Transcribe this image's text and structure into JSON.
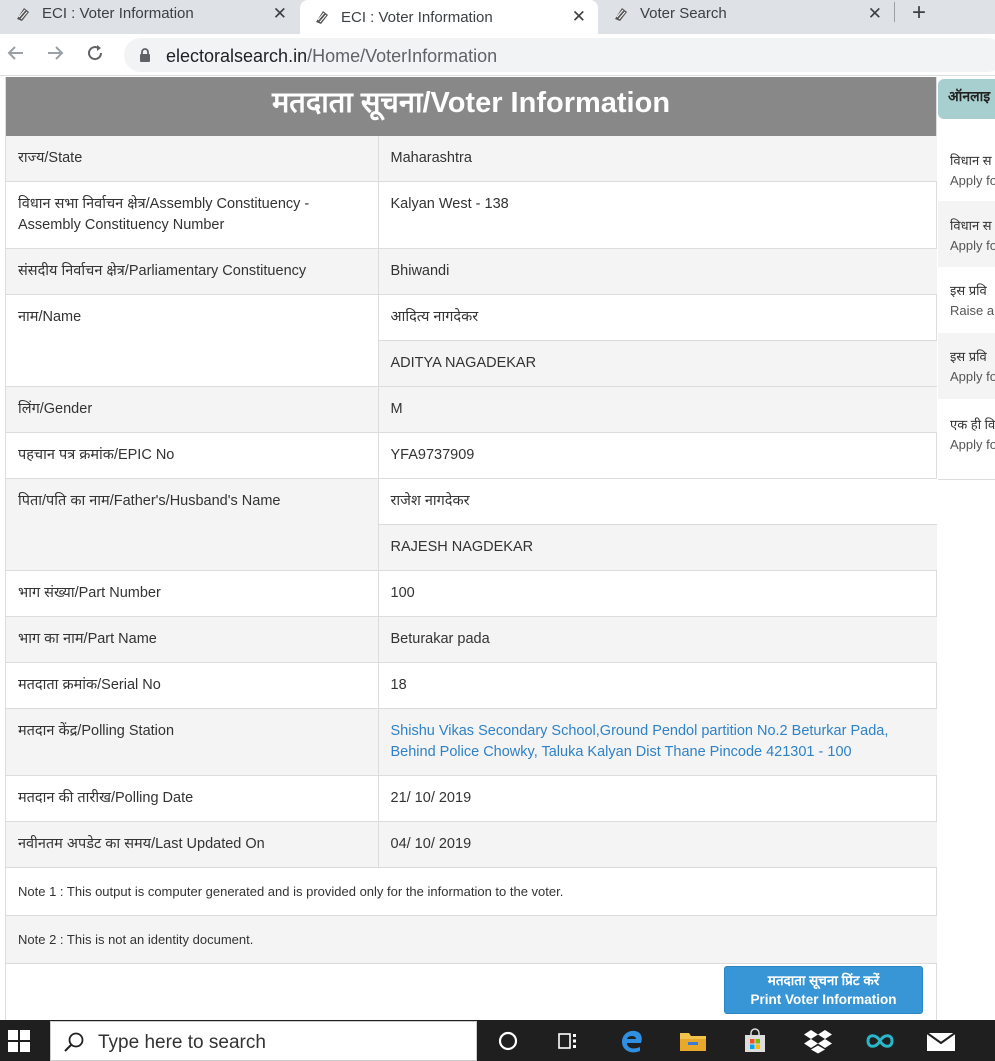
{
  "browser": {
    "tabs": [
      {
        "title": "ECI : Voter Information",
        "close": "✕"
      },
      {
        "title": "ECI : Voter Information",
        "close": "✕"
      },
      {
        "title": "Voter Search",
        "close": "✕"
      }
    ],
    "new_tab": "+",
    "url_host": "electoralsearch.in",
    "url_path": "/Home/VoterInformation"
  },
  "page": {
    "title": "मतदाता सूचना/Voter Information",
    "rows": [
      {
        "label": "राज्य/State",
        "value": "Maharashtra"
      },
      {
        "label": "विधान सभा निर्वाचन क्षेत्र/Assembly Constituency - Assembly Constituency Number",
        "value": "Kalyan West - 138"
      },
      {
        "label": "संसदीय निर्वाचन क्षेत्र/Parliamentary Constituency",
        "value": "Bhiwandi"
      },
      {
        "label": "नाम/Name",
        "value": "आदित्य नागदेकर",
        "value2": "ADITYA NAGADEKAR"
      },
      {
        "label": "लिंग/Gender",
        "value": "M"
      },
      {
        "label": "पहचान पत्र क्रमांक/EPIC No",
        "value": "YFA9737909"
      },
      {
        "label": "पिता/पति का नाम/Father's/Husband's Name",
        "value": "राजेश नागदेकर",
        "value2": "RAJESH NAGDEKAR"
      },
      {
        "label": "भाग संख्या/Part Number",
        "value": "100"
      },
      {
        "label": "भाग का नाम/Part Name",
        "value": "Beturakar pada"
      },
      {
        "label": "मतदाता क्रमांक/Serial No",
        "value": "18"
      },
      {
        "label": "मतदान केंद्र/Polling Station",
        "value": "Shishu Vikas Secondary School,Ground Pendol partition No.2 Beturkar Pada, Behind Police Chowky, Taluka Kalyan Dist Thane Pincode 421301 - 100"
      },
      {
        "label": "मतदान की तारीख/Polling Date",
        "value": "21/ 10/ 2019"
      },
      {
        "label": "नवीनतम अपडेट का समय/Last Updated On",
        "value": "04/ 10/ 2019"
      }
    ],
    "note1": "Note 1 : This output is computer generated and is provided only for the information to the voter.",
    "note2": "Note 2 : This is not an identity document.",
    "print_button": {
      "line1": "मतदाता सूचना प्रिंट करें",
      "line2": "Print Voter Information"
    }
  },
  "sidebar": {
    "heading": "ऑनलाइ",
    "items": [
      {
        "line1": "विधान स",
        "line2": "Apply fo"
      },
      {
        "line1": "विधान स",
        "line2": "Apply fo"
      },
      {
        "line1": "इस प्रवि",
        "line2": "Raise a"
      },
      {
        "line1": "इस प्रवि",
        "line2": "Apply fo"
      },
      {
        "line1": "एक ही वि",
        "line2": "Apply fo"
      }
    ]
  },
  "taskbar": {
    "search_placeholder": "Type here to search"
  },
  "colors": {
    "header_bg": "#888888",
    "link": "#2f82c7",
    "print_button": "#3896d6",
    "sidebar_head": "#a7cfcf"
  }
}
